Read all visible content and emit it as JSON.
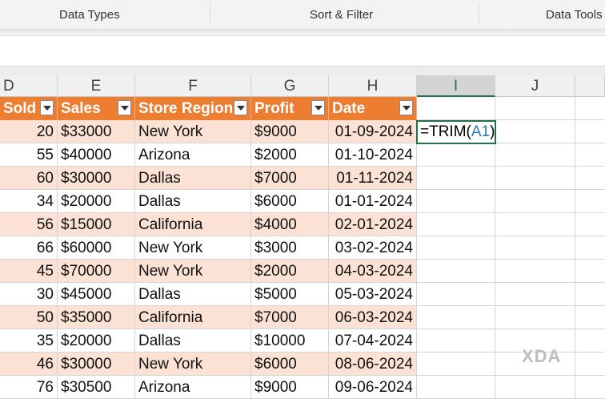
{
  "ribbon": {
    "groups": [
      "Data Types",
      "Sort & Filter",
      "Data Tools"
    ]
  },
  "columns": [
    "D",
    "E",
    "F",
    "G",
    "H",
    "I",
    "J"
  ],
  "table_headers": [
    "Sold",
    "Sales",
    "Store Region",
    "Profit",
    "Date"
  ],
  "rows": [
    [
      "20",
      "$33000",
      "New York",
      "$9000",
      "01-09-2024"
    ],
    [
      "55",
      "$40000",
      "Arizona",
      "$2000",
      "01-10-2024"
    ],
    [
      "60",
      "$30000",
      "Dallas",
      "$7000",
      "01-11-2024"
    ],
    [
      "34",
      "$20000",
      "Dallas",
      "$6000",
      "01-01-2024"
    ],
    [
      "56",
      "$15000",
      "California",
      "$4000",
      "02-01-2024"
    ],
    [
      "66",
      "$60000",
      "New York",
      "$3000",
      "03-02-2024"
    ],
    [
      "45",
      "$70000",
      "New York",
      "$2000",
      "04-03-2024"
    ],
    [
      "30",
      "$45000",
      "Dallas",
      "$5000",
      "05-03-2024"
    ],
    [
      "50",
      "$35000",
      "California",
      "$7000",
      "06-03-2024"
    ],
    [
      "35",
      "$20000",
      "Dallas",
      "$10000",
      "07-04-2024"
    ],
    [
      "46",
      "$30000",
      "New York",
      "$6000",
      "08-06-2024"
    ],
    [
      "76",
      "$30500",
      "Arizona",
      "$9000",
      "09-06-2024"
    ]
  ],
  "formula": {
    "prefix": "=TRIM(",
    "ref": "A1",
    "suffix": ")"
  },
  "watermark": "XDA",
  "colors": {
    "header": "#ed7d31",
    "band": "#fbe2d5",
    "selection": "#217346",
    "cell_ref": "#2e75b6"
  }
}
